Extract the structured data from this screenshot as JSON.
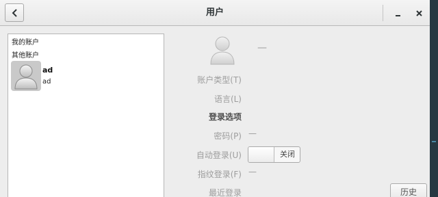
{
  "window": {
    "title": "用户"
  },
  "sidebar": {
    "my_account_header": "我的账户",
    "other_accounts_header": "其他账户",
    "users": [
      {
        "name": "ad",
        "login": "ad"
      }
    ]
  },
  "details": {
    "fullname": "—",
    "account_type_label": "账户类型(T)",
    "language_label": "语言(L)",
    "login_options_label": "登录选项",
    "password_label": "密码(P)",
    "password_value": "—",
    "autologin_label": "自动登录(U)",
    "autologin_state": "关闭",
    "fingerprint_label": "指纹登录(F)",
    "fingerprint_value": "—",
    "last_login_label": "最近登录",
    "history_button": "历史"
  },
  "icons": {
    "back": "chevron-left-icon",
    "minimize": "minimize-icon",
    "close": "close-icon",
    "avatar": "user-avatar-icon"
  }
}
